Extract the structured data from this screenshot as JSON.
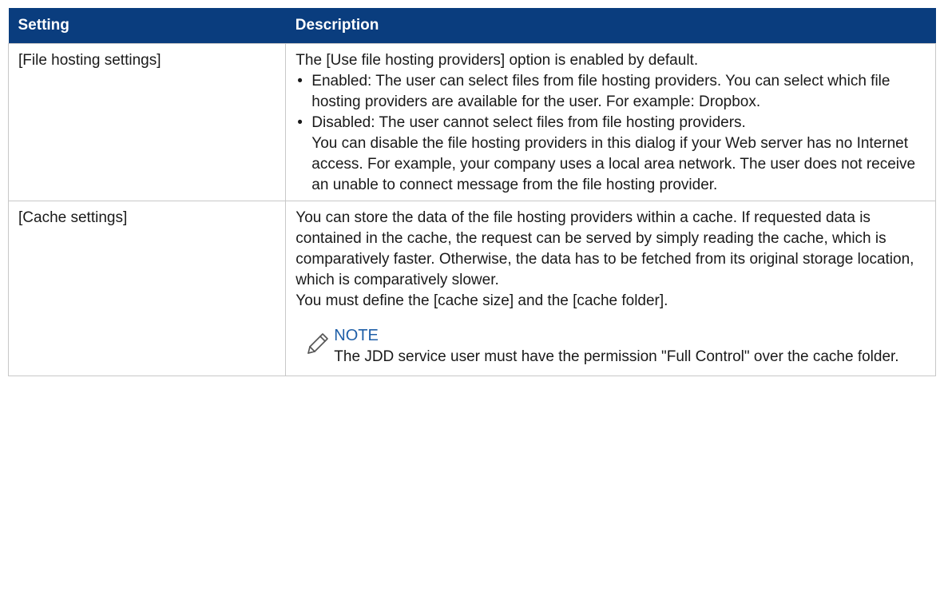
{
  "table": {
    "headers": {
      "setting": "Setting",
      "description": "Description"
    },
    "rows": [
      {
        "setting": "[File hosting settings]",
        "intro": "The [Use file hosting providers] option is enabled by default.",
        "bullets": [
          "Enabled: The user can select files from file hosting providers. You can select which file hosting providers are available for the user. For example: Dropbox.",
          "Disabled: The user cannot select files from file hosting providers."
        ],
        "extra": "You can disable the file hosting providers in this dialog if your Web server has no Internet access. For example, your company uses a local area network. The user does not receive an unable to connect message from the file hosting provider."
      },
      {
        "setting": "[Cache settings]",
        "paragraphs": [
          "You can store the data of the file hosting providers within a cache. If requested data is contained in the cache, the request can be served by simply reading the cache, which is comparatively faster. Otherwise, the data has to be fetched from its original storage location, which is comparatively slower.",
          "You must define the [cache size] and the [cache folder]."
        ],
        "note": {
          "title": "NOTE",
          "text": "The JDD service user must have the permission \"Full Control\" over the cache folder.",
          "icon": "pencil-note-icon",
          "title_color": "#1f5fa8"
        }
      }
    ]
  },
  "colors": {
    "header_bg": "#0a3d7e",
    "border": "#c8c8c8"
  }
}
